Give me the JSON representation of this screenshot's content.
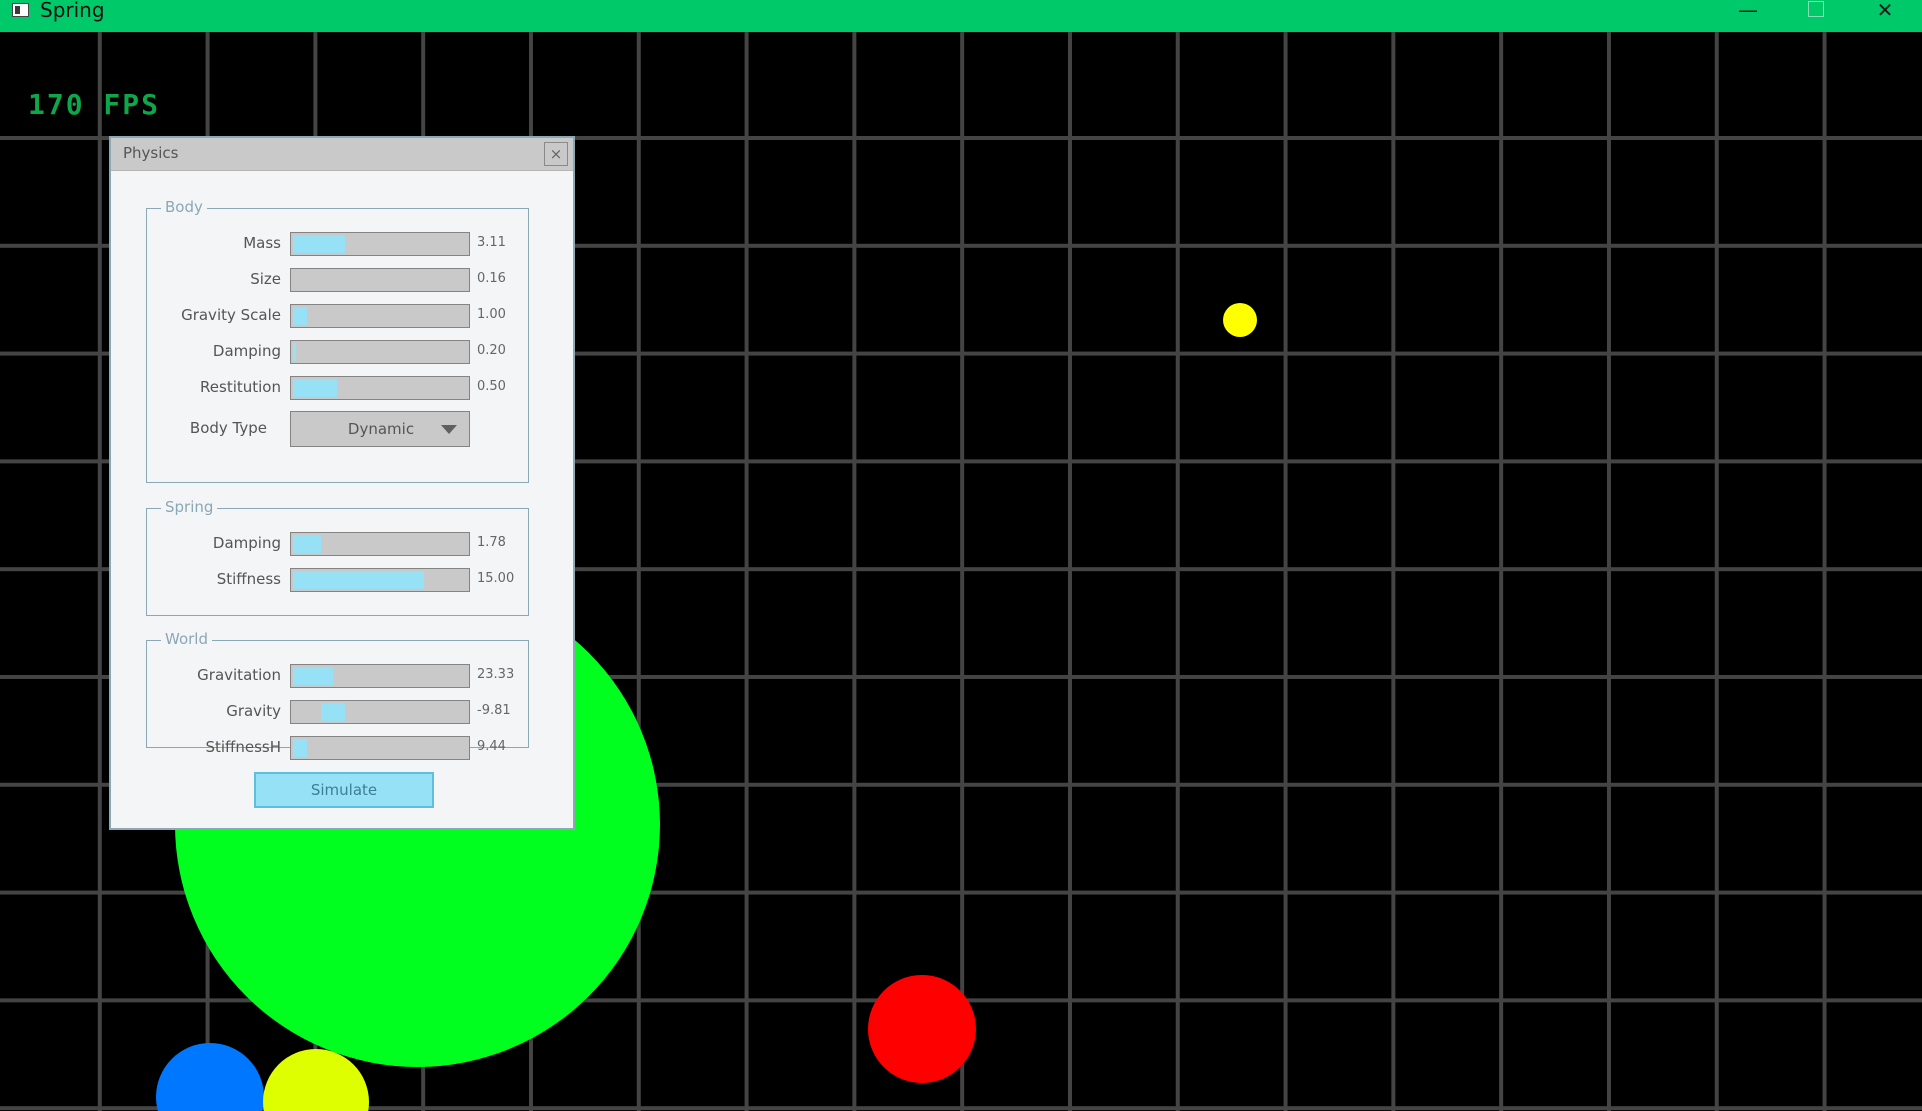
{
  "window": {
    "title": "Spring",
    "minimize_glyph": "—",
    "close_glyph": "✕",
    "icons": {
      "app": "app-window-icon",
      "minimize": "minimize-icon",
      "maximize": "maximize-icon",
      "close": "close-icon"
    }
  },
  "overlay": {
    "fps": "170 FPS"
  },
  "colors": {
    "title_bar": "#00c96a",
    "grid_line": "#444444",
    "background": "#000000",
    "slider_fill": "#96e1f6",
    "bodies": {
      "green": "#00ff1e",
      "yellow": "#ffff00",
      "red": "#ff0000",
      "blue": "#0077ff",
      "lime": "#ddff00"
    }
  },
  "physics_panel": {
    "title": "Physics",
    "close_glyph": "×",
    "body": {
      "label": "Body",
      "mass": {
        "label": "Mass",
        "value": "3.11",
        "fill": 0.3
      },
      "size": {
        "label": "Size",
        "value": "0.16",
        "fill": 0.0
      },
      "gravity_scale": {
        "label": "Gravity Scale",
        "value": "1.00",
        "fill": 0.08
      },
      "damping": {
        "label": "Damping",
        "value": "0.20",
        "fill": 0.02
      },
      "restitution": {
        "label": "Restitution",
        "value": "0.50",
        "fill": 0.25
      },
      "body_type": {
        "label": "Body Type",
        "value": "Dynamic"
      }
    },
    "spring": {
      "label": "Spring",
      "damping": {
        "label": "Damping",
        "value": "1.78",
        "fill": 0.16
      },
      "stiffness": {
        "label": "Stiffness",
        "value": "15.00",
        "fill": 0.75
      }
    },
    "world": {
      "label": "World",
      "gravitation": {
        "label": "Gravitation",
        "value": "23.33",
        "fill": 0.23
      },
      "gravity": {
        "label": "Gravity",
        "value": "-9.81",
        "fill_start": 0.16,
        "fill": 0.14
      },
      "stiffnessh": {
        "label": "StiffnessH",
        "value": "9.44",
        "fill": 0.08
      }
    },
    "simulate_label": "Simulate"
  }
}
